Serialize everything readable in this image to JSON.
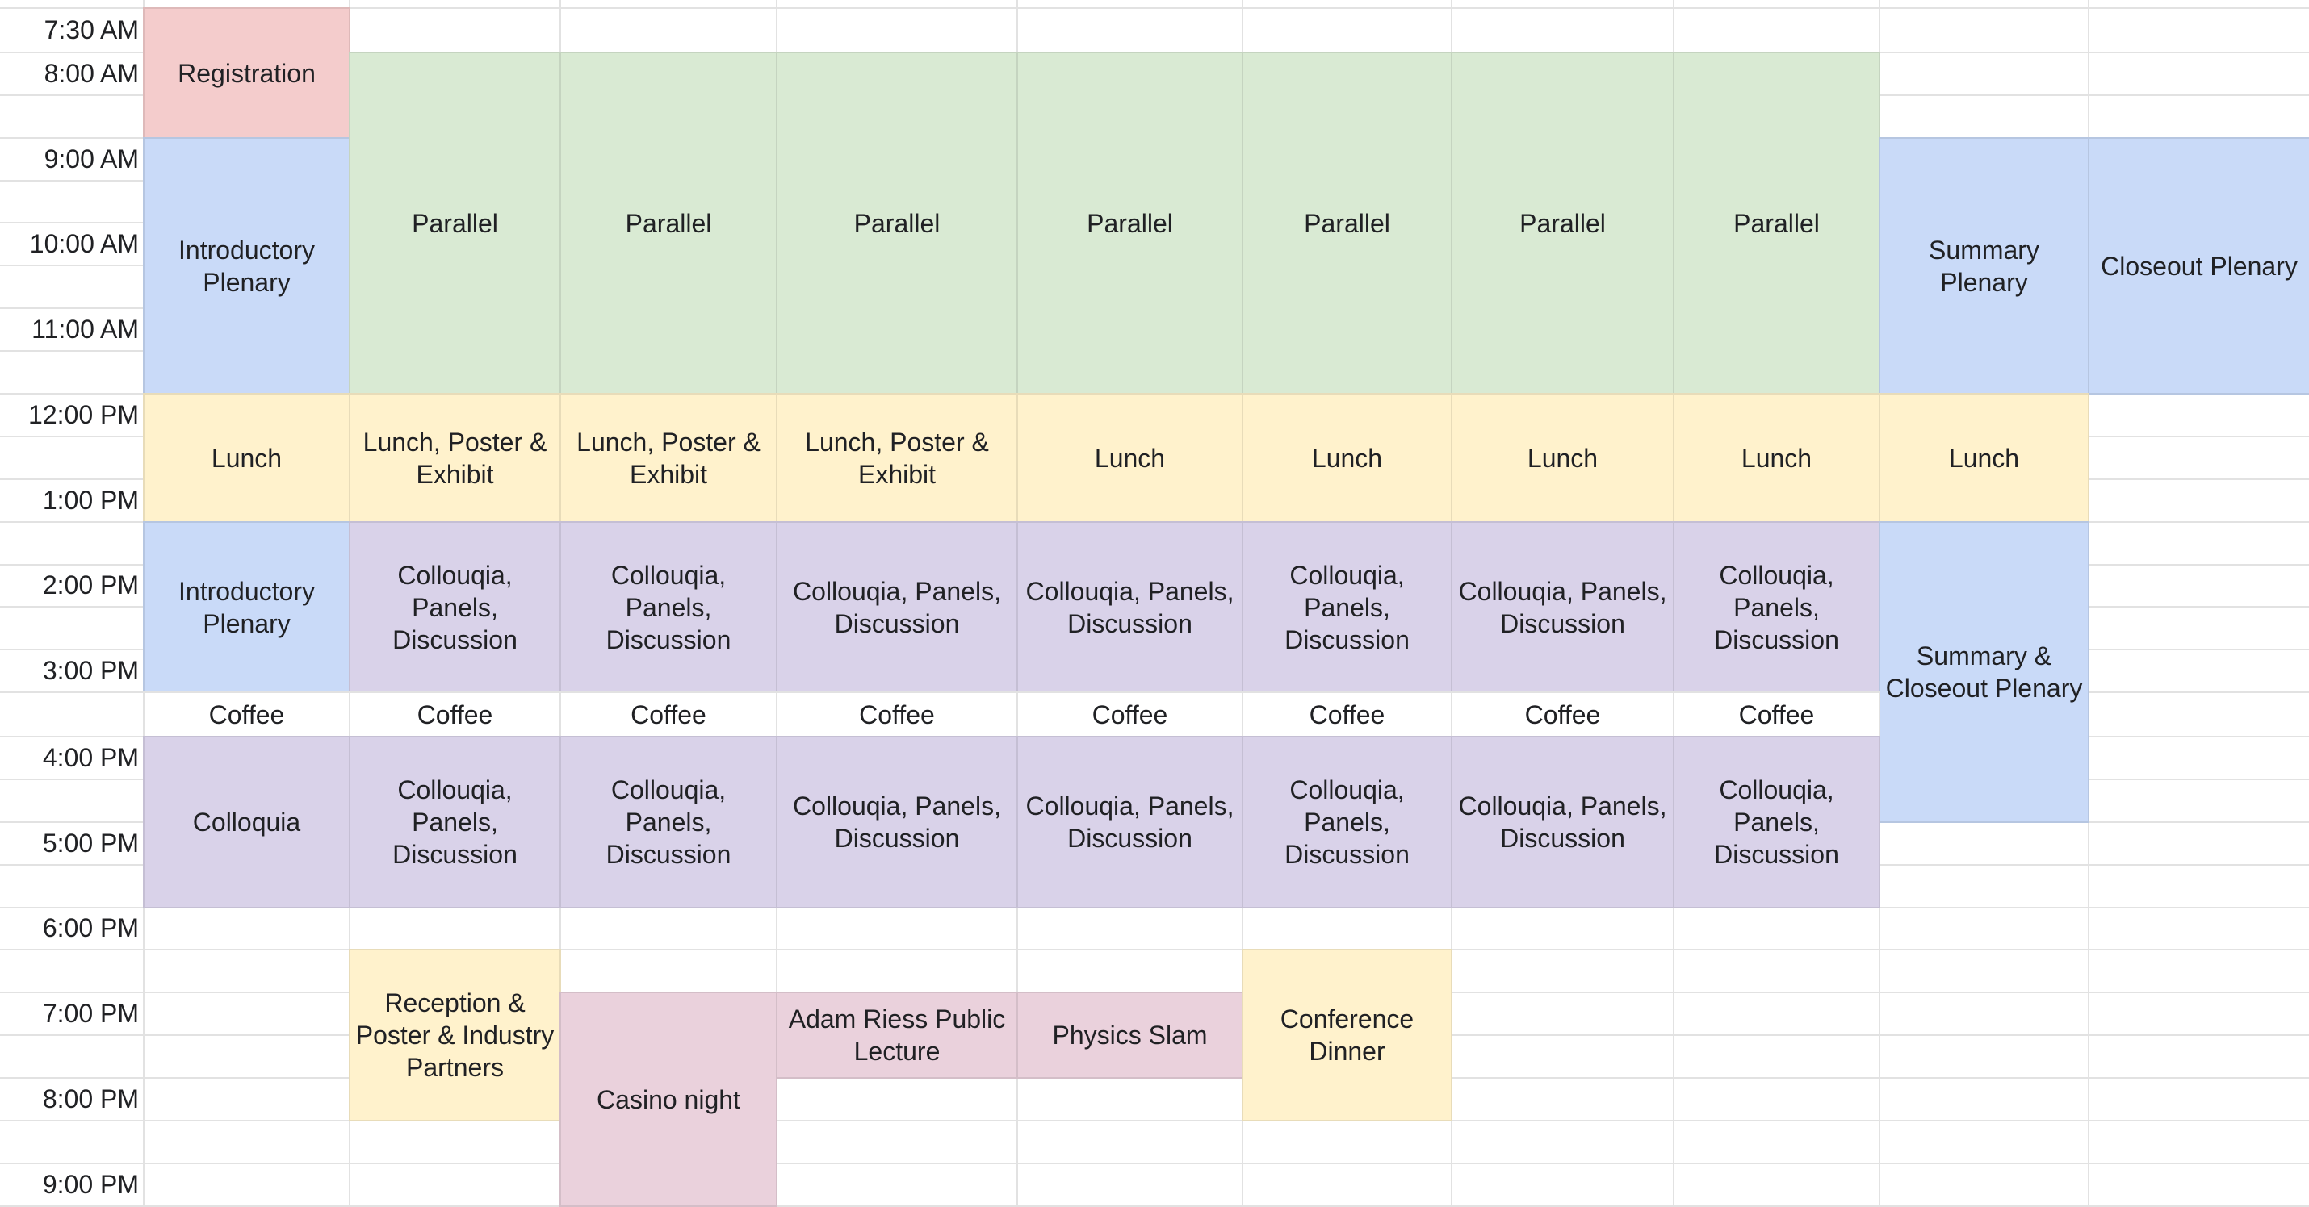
{
  "time_labels": [
    "7:30 AM",
    "8:00 AM",
    "9:00 AM",
    "10:00 AM",
    "11:00 AM",
    "12:00 PM",
    "1:00 PM",
    "2:00 PM",
    "3:00 PM",
    "4:00 PM",
    "5:00 PM",
    "6:00 PM",
    "7:00 PM",
    "8:00 PM",
    "9:00 PM"
  ],
  "colors": {
    "registration": "#f4cccc",
    "plenary": "#c9daf8",
    "parallel": "#d9ead3",
    "lunch": "#fff2cc",
    "colloquia": "#d9d2e9",
    "evening_mauve": "#ead1dc",
    "evening_yellow": "#fff2cc",
    "coffee": "#ffffff",
    "gridline": "#e2e2e2"
  },
  "blocks": [
    {
      "name": "registration-block",
      "text": "Registration",
      "color": "registration"
    },
    {
      "name": "introductory-plenary-morning-block",
      "text": "Introductory Plenary",
      "color": "plenary"
    },
    {
      "name": "parallel-block-1",
      "text": "Parallel",
      "color": "parallel"
    },
    {
      "name": "parallel-block-2",
      "text": "Parallel",
      "color": "parallel"
    },
    {
      "name": "parallel-block-3",
      "text": "Parallel",
      "color": "parallel"
    },
    {
      "name": "parallel-block-4",
      "text": "Parallel",
      "color": "parallel"
    },
    {
      "name": "parallel-block-5",
      "text": "Parallel",
      "color": "parallel"
    },
    {
      "name": "parallel-block-6",
      "text": "Parallel",
      "color": "parallel"
    },
    {
      "name": "parallel-block-7",
      "text": "Parallel",
      "color": "parallel"
    },
    {
      "name": "summary-plenary-block",
      "text": "Summary Plenary",
      "color": "plenary"
    },
    {
      "name": "closeout-plenary-block",
      "text": "Closeout Plenary",
      "color": "plenary"
    },
    {
      "name": "lunch-block-1",
      "text": "Lunch",
      "color": "lunch"
    },
    {
      "name": "lunch-poster-exhibit-block-2",
      "text": "Lunch, Poster & Exhibit",
      "color": "lunch"
    },
    {
      "name": "lunch-poster-exhibit-block-3",
      "text": "Lunch, Poster & Exhibit",
      "color": "lunch"
    },
    {
      "name": "lunch-poster-exhibit-block-4",
      "text": "Lunch, Poster & Exhibit",
      "color": "lunch"
    },
    {
      "name": "lunch-block-5",
      "text": "Lunch",
      "color": "lunch"
    },
    {
      "name": "lunch-block-6",
      "text": "Lunch",
      "color": "lunch"
    },
    {
      "name": "lunch-block-7",
      "text": "Lunch",
      "color": "lunch"
    },
    {
      "name": "lunch-block-8",
      "text": "Lunch",
      "color": "lunch"
    },
    {
      "name": "lunch-block-9",
      "text": "Lunch",
      "color": "lunch"
    },
    {
      "name": "introductory-plenary-afternoon-block",
      "text": "Introductory Plenary",
      "color": "plenary"
    },
    {
      "name": "colloquia-panels-block-2-pm1",
      "text": "Collouqia, Panels, Discussion",
      "color": "colloquia"
    },
    {
      "name": "colloquia-panels-block-3-pm1",
      "text": "Collouqia, Panels, Discussion",
      "color": "colloquia"
    },
    {
      "name": "colloquia-panels-block-4-pm1",
      "text": "Collouqia, Panels, Discussion",
      "color": "colloquia"
    },
    {
      "name": "colloquia-panels-block-5-pm1",
      "text": "Collouqia, Panels, Discussion",
      "color": "colloquia"
    },
    {
      "name": "colloquia-panels-block-6-pm1",
      "text": "Collouqia, Panels, Discussion",
      "color": "colloquia"
    },
    {
      "name": "colloquia-panels-block-7-pm1",
      "text": "Collouqia, Panels, Discussion",
      "color": "colloquia"
    },
    {
      "name": "colloquia-panels-block-8-pm1",
      "text": "Collouqia, Panels, Discussion",
      "color": "colloquia"
    },
    {
      "name": "summary-closeout-plenary-block",
      "text": "Summary & Closeout Plenary",
      "color": "plenary"
    },
    {
      "name": "coffee-block-1",
      "text": "Coffee",
      "color": "coffee"
    },
    {
      "name": "coffee-block-2",
      "text": "Coffee",
      "color": "coffee"
    },
    {
      "name": "coffee-block-3",
      "text": "Coffee",
      "color": "coffee"
    },
    {
      "name": "coffee-block-4",
      "text": "Coffee",
      "color": "coffee"
    },
    {
      "name": "coffee-block-5",
      "text": "Coffee",
      "color": "coffee"
    },
    {
      "name": "coffee-block-6",
      "text": "Coffee",
      "color": "coffee"
    },
    {
      "name": "coffee-block-7",
      "text": "Coffee",
      "color": "coffee"
    },
    {
      "name": "coffee-block-8",
      "text": "Coffee",
      "color": "coffee"
    },
    {
      "name": "colloquia-block-1",
      "text": "Colloquia",
      "color": "colloquia"
    },
    {
      "name": "colloquia-panels-block-2-pm2",
      "text": "Collouqia, Panels, Discussion",
      "color": "colloquia"
    },
    {
      "name": "colloquia-panels-block-3-pm2",
      "text": "Collouqia, Panels, Discussion",
      "color": "colloquia"
    },
    {
      "name": "colloquia-panels-block-4-pm2",
      "text": "Collouqia, Panels, Discussion",
      "color": "colloquia"
    },
    {
      "name": "colloquia-panels-block-5-pm2",
      "text": "Collouqia, Panels, Discussion",
      "color": "colloquia"
    },
    {
      "name": "colloquia-panels-block-6-pm2",
      "text": "Collouqia, Panels, Discussion",
      "color": "colloquia"
    },
    {
      "name": "colloquia-panels-block-7-pm2",
      "text": "Collouqia, Panels, Discussion",
      "color": "colloquia"
    },
    {
      "name": "colloquia-panels-block-8-pm2",
      "text": "Collouqia, Panels, Discussion",
      "color": "colloquia"
    },
    {
      "name": "reception-block",
      "text": "Reception & Poster & Industry Partners",
      "color": "evening_yellow"
    },
    {
      "name": "casino-night-block",
      "text": "Casino night",
      "color": "evening_mauve"
    },
    {
      "name": "public-lecture-block",
      "text": "Adam Riess Public Lecture",
      "color": "evening_mauve"
    },
    {
      "name": "physics-slam-block",
      "text": "Physics Slam",
      "color": "evening_mauve"
    },
    {
      "name": "conference-dinner-block",
      "text": "Conference Dinner",
      "color": "evening_yellow"
    }
  ]
}
